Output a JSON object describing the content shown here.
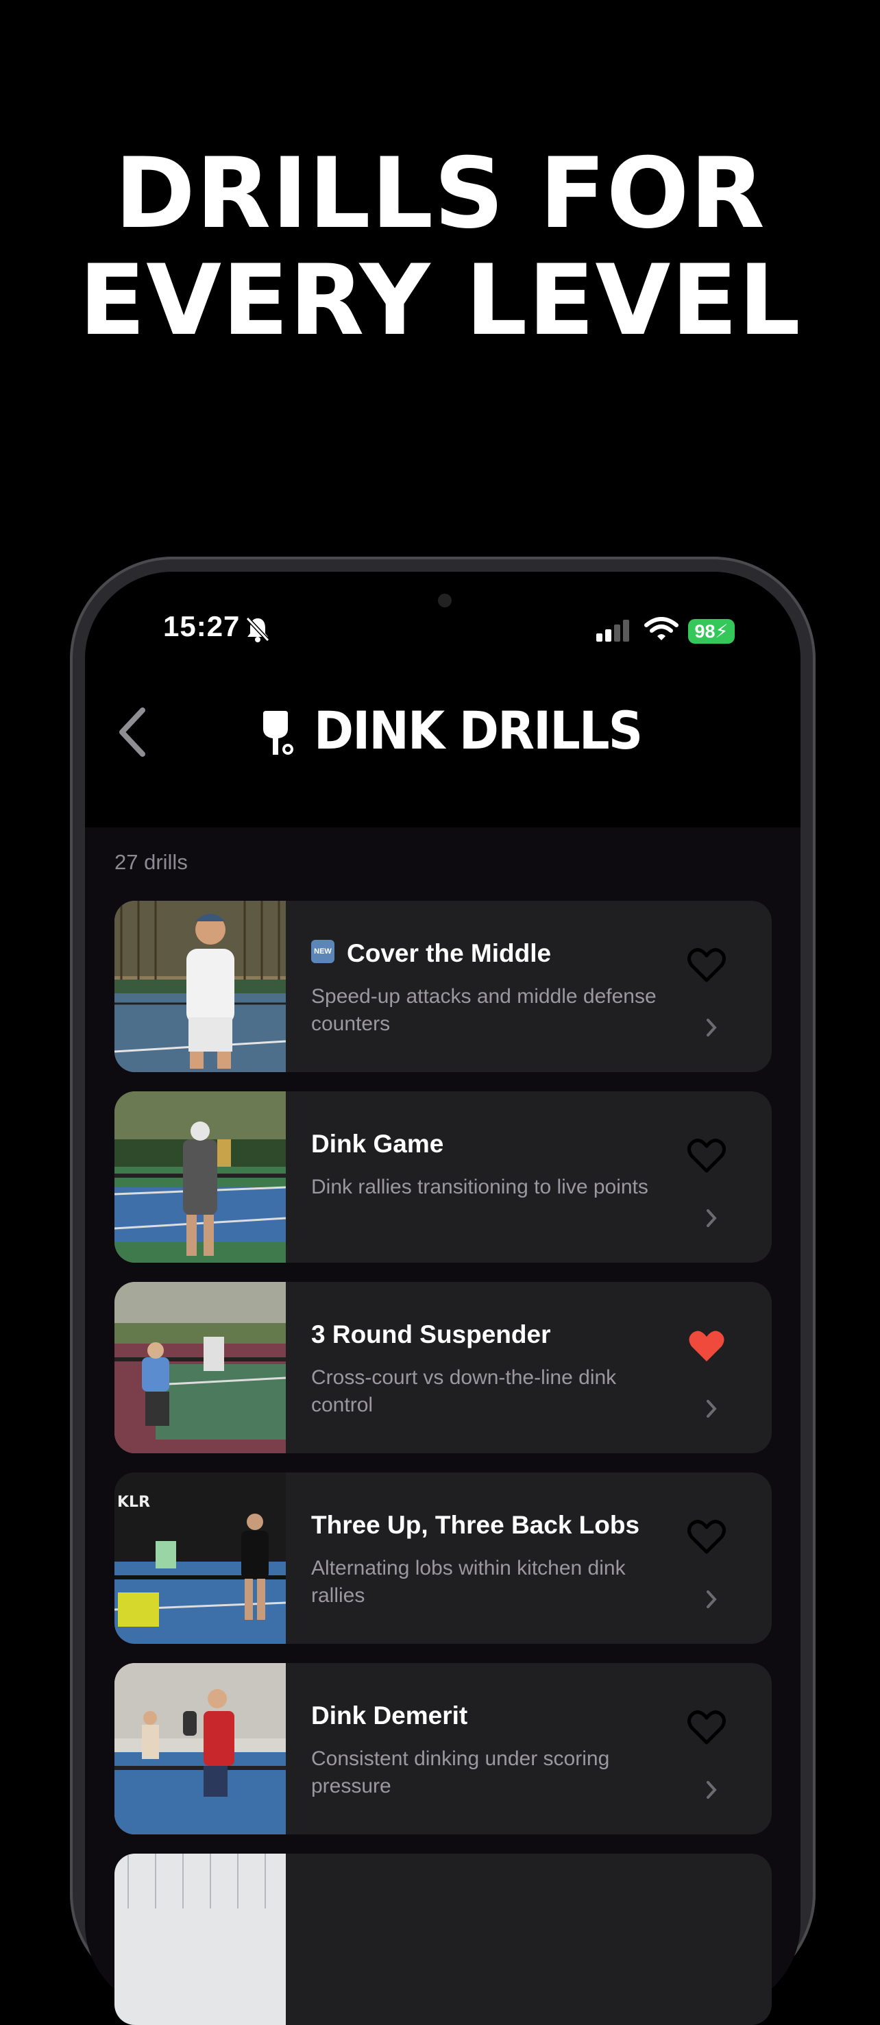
{
  "headline": {
    "line1": "DRILLS FOR",
    "line2": "EVERY LEVEL"
  },
  "status_bar": {
    "time": "15:27",
    "battery": "98"
  },
  "header": {
    "title": "DINK DRILLS"
  },
  "drill_count": "27 drills",
  "drills": [
    {
      "badge": "NEW",
      "title": "Cover the Middle",
      "description": "Speed-up attacks and middle defense counters",
      "favorited": false
    },
    {
      "title": "Dink Game",
      "description": "Dink rallies transitioning to live points",
      "favorited": false
    },
    {
      "title": "3 Round Suspender",
      "description": "Cross-court vs down-the-line dink control",
      "favorited": true
    },
    {
      "title": "Three Up, Three Back Lobs",
      "description": "Alternating lobs within kitchen dink rallies",
      "favorited": false
    },
    {
      "title": "Dink Demerit",
      "description": "Consistent dinking under scoring pressure",
      "favorited": false
    }
  ],
  "thumb_wall_text": "KLR",
  "colors": {
    "favorite": "#ef4a3c",
    "battery": "#34c759",
    "card": "#1f1f21"
  }
}
